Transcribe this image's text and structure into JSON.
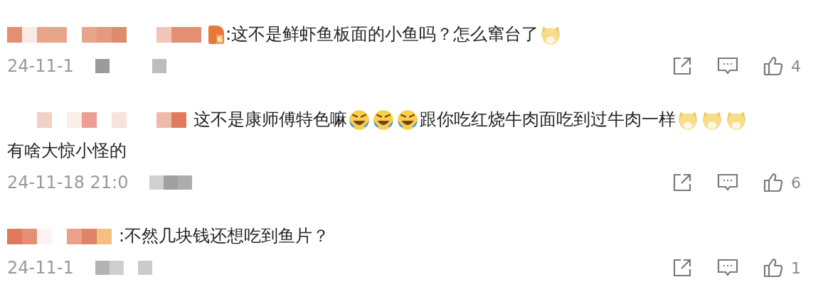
{
  "comments": [
    {
      "author": {
        "kind": "redacted"
      },
      "badge": "6",
      "content": [
        {
          "kind": "text",
          "text": ":这不是鲜虾鱼板面的小鱼吗？怎么窜台了"
        },
        {
          "kind": "doge"
        }
      ],
      "time": "24-11-1",
      "likes": "4"
    },
    {
      "author": {
        "kind": "redacted"
      },
      "content": [
        {
          "kind": "text",
          "text": "这不是康师傅特色嘛"
        },
        {
          "kind": "laugh-cry"
        },
        {
          "kind": "laugh-cry"
        },
        {
          "kind": "laugh-cry"
        },
        {
          "kind": "text",
          "text": "跟你吃红烧牛肉面吃到过牛肉一样"
        },
        {
          "kind": "doge"
        },
        {
          "kind": "doge"
        },
        {
          "kind": "doge"
        },
        {
          "kind": "text",
          "text": "有啥大惊小怪的"
        }
      ],
      "time": "24-11-18 21:0",
      "likes": "6"
    },
    {
      "author": {
        "kind": "redacted"
      },
      "content": [
        {
          "kind": "text",
          "text": ":不然几块钱还想吃到鱼片？"
        }
      ],
      "time": "24-11-1",
      "likes": "1"
    }
  ]
}
